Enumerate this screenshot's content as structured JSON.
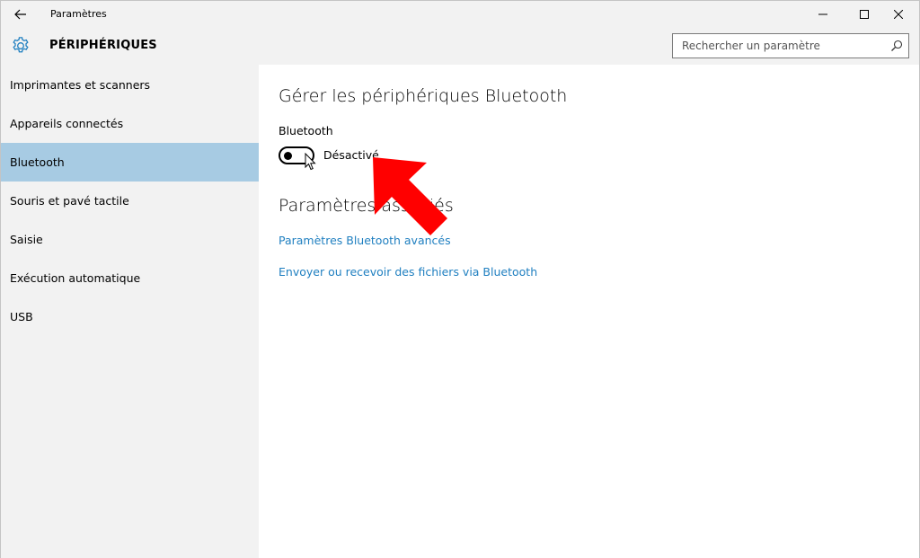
{
  "window": {
    "title": "Paramètres"
  },
  "header": {
    "section_title": "PÉRIPHÉRIQUES",
    "search_placeholder": "Rechercher un paramètre"
  },
  "sidebar": {
    "items": [
      {
        "label": "Imprimantes et scanners",
        "active": false
      },
      {
        "label": "Appareils connectés",
        "active": false
      },
      {
        "label": "Bluetooth",
        "active": true
      },
      {
        "label": "Souris et pavé tactile",
        "active": false
      },
      {
        "label": "Saisie",
        "active": false
      },
      {
        "label": "Exécution automatique",
        "active": false
      },
      {
        "label": "USB",
        "active": false
      }
    ]
  },
  "main": {
    "page_title": "Gérer les périphériques Bluetooth",
    "bluetooth_label": "Bluetooth",
    "bluetooth_state": "Désactivé",
    "bluetooth_on": false,
    "related_title": "Paramètres associés",
    "links": [
      "Paramètres Bluetooth avancés",
      "Envoyer ou recevoir des fichiers via Bluetooth"
    ]
  },
  "colors": {
    "accent_link": "#1f7fc0",
    "active_nav": "#a7cbe3",
    "chrome": "#f2f2f2",
    "annotation_arrow": "#ff0000"
  },
  "icons": {
    "back": "arrow-left-icon",
    "settings": "gear-icon",
    "search": "search-icon",
    "minimize": "minimize-icon",
    "maximize": "maximize-icon",
    "close": "close-icon"
  }
}
